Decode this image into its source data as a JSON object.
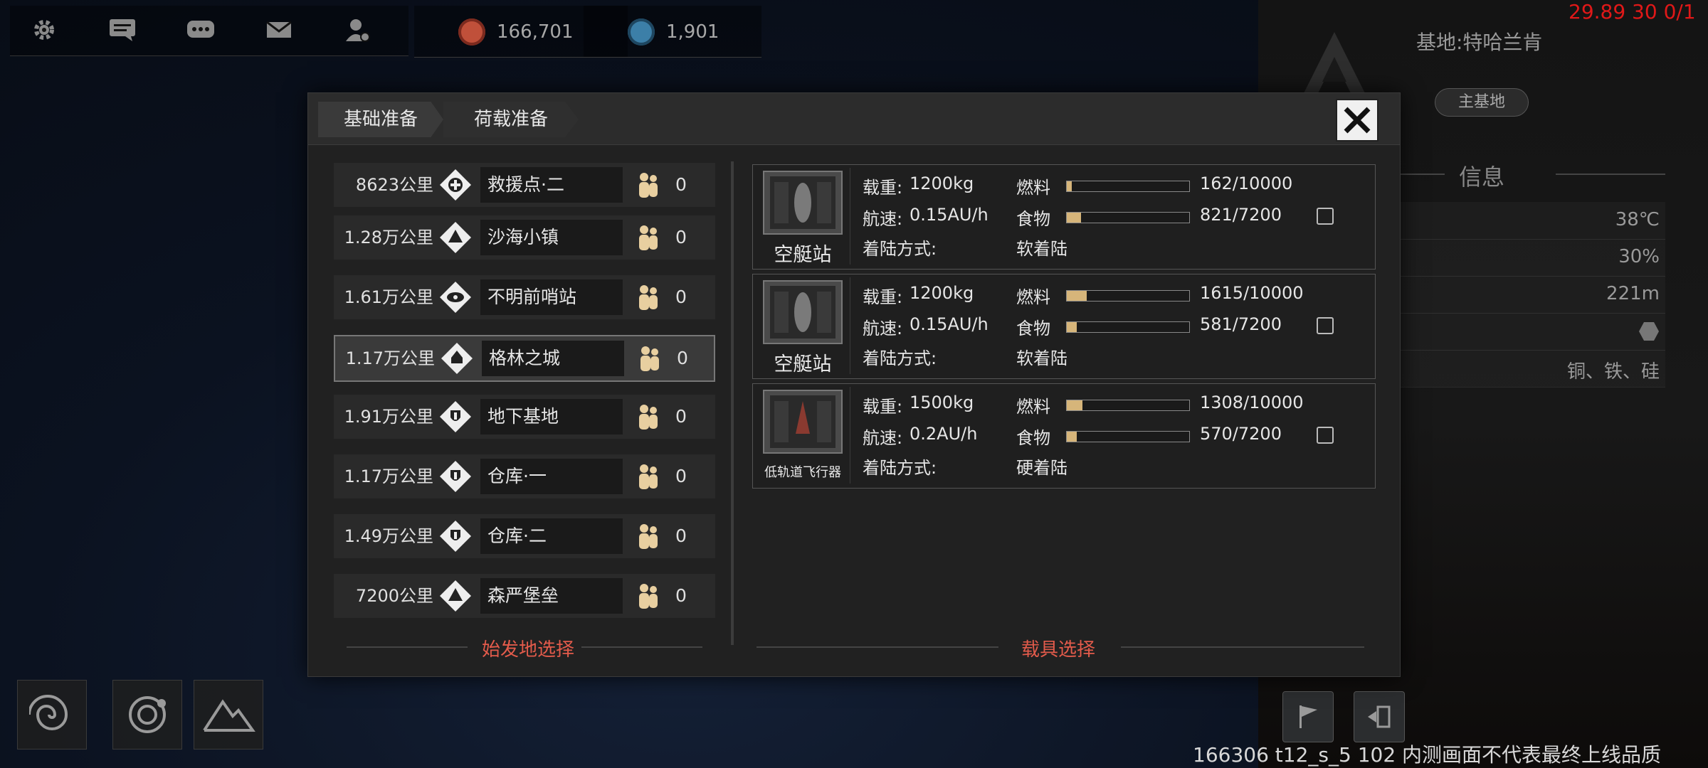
{
  "topbar": {
    "icons": [
      "gear-icon",
      "chat-icon",
      "message-bubble-icon",
      "mail-icon",
      "user-icon"
    ],
    "resources": [
      {
        "icon": "mineral-resource-icon",
        "value": "166,701",
        "color": "#c0503a"
      },
      {
        "icon": "tech-resource-icon",
        "value": "1,901",
        "color": "#3c7fa8"
      }
    ]
  },
  "right_panel": {
    "base_name": "基地:特哈兰肯",
    "base_tag": "主基地",
    "info_title": "信息",
    "stats": [
      "38℃",
      "30%",
      "221m",
      "",
      "铜、铁、硅"
    ]
  },
  "debug": {
    "fps": "29.89 30 0/1",
    "watermark": "166306 t12_s_5 102 内测画面不代表最终上线品质"
  },
  "modal": {
    "tabs": [
      "基础准备",
      "荷载准备"
    ],
    "origin_section_title": "始发地选择",
    "vehicle_section_title": "载具选择",
    "origins": [
      {
        "distance": "8623公里",
        "name": "救援点·二",
        "icon": "rescue-plus-icon",
        "count": "0"
      },
      {
        "distance": "1.28万公里",
        "name": "沙海小镇",
        "icon": "town-icon",
        "count": "0"
      },
      {
        "distance": "1.61万公里",
        "name": "不明前哨站",
        "icon": "outpost-eye-icon",
        "count": "0"
      },
      {
        "distance": "1.17万公里",
        "name": "格林之城",
        "icon": "city-icon",
        "count": "0",
        "selected": true
      },
      {
        "distance": "1.91万公里",
        "name": "地下基地",
        "icon": "shield-icon",
        "count": "0"
      },
      {
        "distance": "1.17万公里",
        "name": "仓库·一",
        "icon": "shield-icon",
        "count": "0"
      },
      {
        "distance": "1.49万公里",
        "name": "仓库·二",
        "icon": "shield-icon",
        "count": "0"
      },
      {
        "distance": "7200公里",
        "name": "森严堡垒",
        "icon": "fortress-icon",
        "count": "0"
      }
    ],
    "vehicles": [
      {
        "name": "空艇站",
        "load_label": "载重:",
        "load": "1200kg",
        "speed_label": "航速:",
        "speed": "0.15AU/h",
        "landing_label": "着陆方式:",
        "landing": "软着陆",
        "fuel_label": "燃料",
        "fuel": "162/10000",
        "fuel_ratio": 0.0162,
        "food_label": "食物",
        "food": "821/7200",
        "food_ratio": 0.114
      },
      {
        "name": "空艇站",
        "load_label": "载重:",
        "load": "1200kg",
        "speed_label": "航速:",
        "speed": "0.15AU/h",
        "landing_label": "着陆方式:",
        "landing": "软着陆",
        "fuel_label": "燃料",
        "fuel": "1615/10000",
        "fuel_ratio": 0.1615,
        "food_label": "食物",
        "food": "581/7200",
        "food_ratio": 0.0807
      },
      {
        "name": "低轨道飞行器",
        "load_label": "载重:",
        "load": "1500kg",
        "speed_label": "航速:",
        "speed": "0.2AU/h",
        "landing_label": "着陆方式:",
        "landing": "硬着陆",
        "fuel_label": "燃料",
        "fuel": "1308/10000",
        "fuel_ratio": 0.1308,
        "food_label": "食物",
        "food": "570/7200",
        "food_ratio": 0.0792
      }
    ]
  },
  "bottom_buttons": [
    "galaxy-icon",
    "planet-orbit-icon",
    "mountain-icon"
  ],
  "right_bottom_buttons": [
    "flag-icon",
    "exit-icon"
  ],
  "colors": {
    "accent_red": "#e35b4b",
    "bar_fill": "#d6b57a"
  }
}
